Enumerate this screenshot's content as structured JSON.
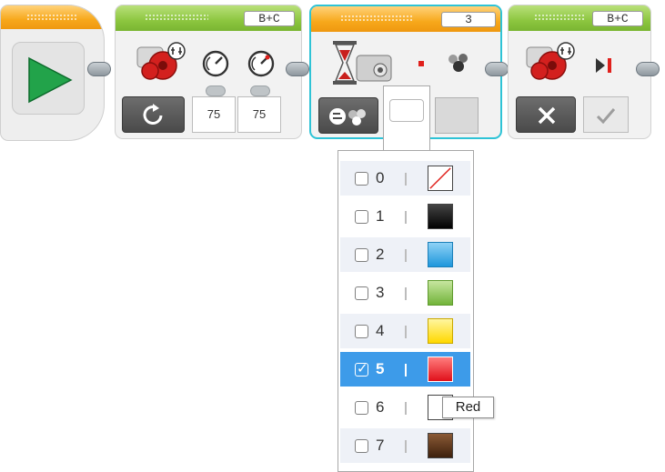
{
  "program": {
    "motor_block": {
      "ports": "B+C",
      "power_b": "75",
      "power_c": "75"
    },
    "color_wait_block": {
      "value": "3"
    },
    "stop_block": {
      "ports": "B+C"
    }
  },
  "color_dropdown": {
    "items": [
      {
        "num": "0",
        "name": "No Color",
        "color": "#ffffff",
        "checked": false
      },
      {
        "num": "1",
        "name": "Black",
        "color": "#000000",
        "checked": false
      },
      {
        "num": "2",
        "name": "Blue",
        "color": "#2ea8e6",
        "checked": false
      },
      {
        "num": "3",
        "name": "Green",
        "color": "#8cc63f",
        "checked": false
      },
      {
        "num": "4",
        "name": "Yellow",
        "color": "#ffe600",
        "checked": false
      },
      {
        "num": "5",
        "name": "Red",
        "color": "#e8141c",
        "checked": true
      },
      {
        "num": "6",
        "name": "White",
        "color": "#ffffff",
        "checked": false
      },
      {
        "num": "7",
        "name": "Brown",
        "color": "#5a3418",
        "checked": false
      }
    ],
    "tooltip": "Red"
  },
  "colors": {
    "selection": "#3d9be9",
    "block_green": "#8cc63f",
    "block_orange": "#f7a81b",
    "selected_outline": "#2ec3d6",
    "start_green": "#22a34a"
  }
}
